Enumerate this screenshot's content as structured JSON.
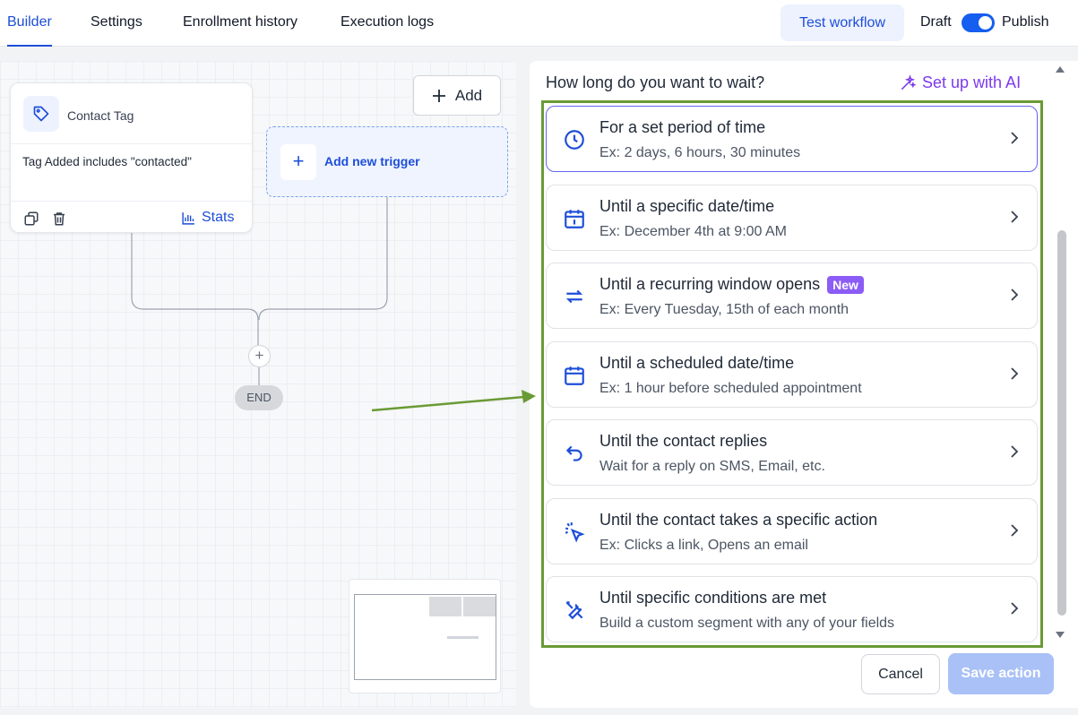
{
  "nav": {
    "tabs": [
      {
        "label": "Builder"
      },
      {
        "label": "Settings"
      },
      {
        "label": "Enrollment history"
      },
      {
        "label": "Execution logs"
      }
    ],
    "test_workflow": "Test workflow",
    "draft": "Draft",
    "publish": "Publish",
    "published": true
  },
  "canvas": {
    "trigger": {
      "title": "Contact Tag",
      "description": "Tag Added includes \"contacted\"",
      "stats_label": "Stats"
    },
    "add_label": "Add",
    "add_trigger_label": "Add new trigger",
    "end_label": "END"
  },
  "panel": {
    "question": "How long do you want to wait?",
    "ai_label": "Set up with AI",
    "options": [
      {
        "title": "For a set period of time",
        "subtitle": "Ex: 2 days, 6 hours, 30 minutes",
        "icon": "clock-icon"
      },
      {
        "title": "Until a specific date/time",
        "subtitle": "Ex: December 4th at 9:00 AM",
        "icon": "calendar-day-icon"
      },
      {
        "title": "Until a recurring window opens",
        "subtitle": "Ex: Every Tuesday, 15th of each month",
        "icon": "repeat-icon",
        "badge": "New"
      },
      {
        "title": "Until a scheduled date/time",
        "subtitle": "Ex: 1 hour before scheduled appointment",
        "icon": "calendar-icon"
      },
      {
        "title": "Until the contact replies",
        "subtitle": "Wait for a reply on SMS, Email, etc.",
        "icon": "reply-icon"
      },
      {
        "title": "Until the contact takes a specific action",
        "subtitle": "Ex: Clicks a link, Opens an email",
        "icon": "cursor-click-icon"
      },
      {
        "title": "Until specific conditions are met",
        "subtitle": "Build a custom segment with any of your fields",
        "icon": "tools-icon"
      }
    ],
    "cancel_label": "Cancel",
    "save_label": "Save action"
  },
  "colors": {
    "accent": "#1d4ed8",
    "ai_purple": "#7c3aed",
    "highlight_green": "#6a9a35"
  }
}
